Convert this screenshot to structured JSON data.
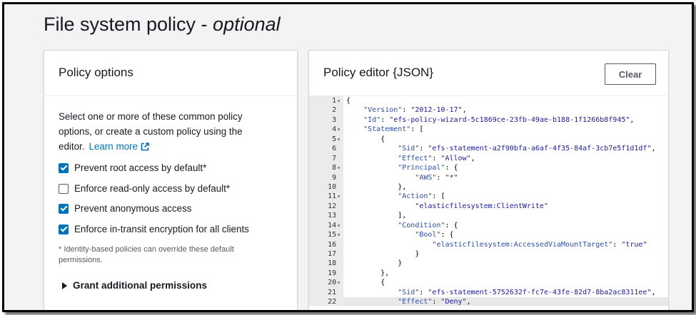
{
  "page": {
    "title": "File system policy - ",
    "title_optional": "optional"
  },
  "options_panel": {
    "title": "Policy options",
    "description": "Select one or more of these common policy options, or create a custom policy using the editor.",
    "learn_more": "Learn more",
    "checkboxes": [
      {
        "label": "Prevent root access by default*",
        "checked": true
      },
      {
        "label": "Enforce read-only access by default*",
        "checked": false
      },
      {
        "label": "Prevent anonymous access",
        "checked": true
      },
      {
        "label": "Enforce in-transit encryption for all clients",
        "checked": true
      }
    ],
    "footnote": "* Identity-based policies can override these default permissions.",
    "grant_label": "Grant additional permissions"
  },
  "editor_panel": {
    "title": "Policy editor {JSON}",
    "clear_label": "Clear",
    "lines": [
      {
        "n": "1",
        "fold": true,
        "text": "{"
      },
      {
        "n": "2",
        "fold": false,
        "text": "    \"Version\": \"2012-10-17\","
      },
      {
        "n": "3",
        "fold": false,
        "text": "    \"Id\": \"efs-policy-wizard-5c1869ce-23fb-49ae-b188-1f1266b8f945\","
      },
      {
        "n": "4",
        "fold": true,
        "text": "    \"Statement\": ["
      },
      {
        "n": "5",
        "fold": true,
        "text": "        {"
      },
      {
        "n": "6",
        "fold": false,
        "text": "            \"Sid\": \"efs-statement-a2f90bfa-a6af-4f35-84af-3cb7e5f1d1df\","
      },
      {
        "n": "7",
        "fold": false,
        "text": "            \"Effect\": \"Allow\","
      },
      {
        "n": "8",
        "fold": true,
        "text": "            \"Principal\": {"
      },
      {
        "n": "9",
        "fold": false,
        "text": "                \"AWS\": \"*\""
      },
      {
        "n": "10",
        "fold": false,
        "text": "            },"
      },
      {
        "n": "11",
        "fold": true,
        "text": "            \"Action\": ["
      },
      {
        "n": "12",
        "fold": false,
        "text": "                \"elasticfilesystem:ClientWrite\""
      },
      {
        "n": "13",
        "fold": false,
        "text": "            ],"
      },
      {
        "n": "14",
        "fold": true,
        "text": "            \"Condition\": {"
      },
      {
        "n": "15",
        "fold": true,
        "text": "                \"Bool\": {"
      },
      {
        "n": "16",
        "fold": false,
        "text": "                    \"elasticfilesystem:AccessedViaMountTarget\": \"true\""
      },
      {
        "n": "17",
        "fold": false,
        "text": "                }"
      },
      {
        "n": "18",
        "fold": false,
        "text": "            }"
      },
      {
        "n": "19",
        "fold": false,
        "text": "        },"
      },
      {
        "n": "20",
        "fold": true,
        "text": "        {"
      },
      {
        "n": "21",
        "fold": false,
        "text": "            \"Sid\": \"efs-statement-5752632f-fc7e-43fe-82d7-8ba2ac8311ee\","
      },
      {
        "n": "22",
        "fold": false,
        "text": "            \"Effect\": \"Deny\","
      }
    ],
    "active_line": "22"
  }
}
